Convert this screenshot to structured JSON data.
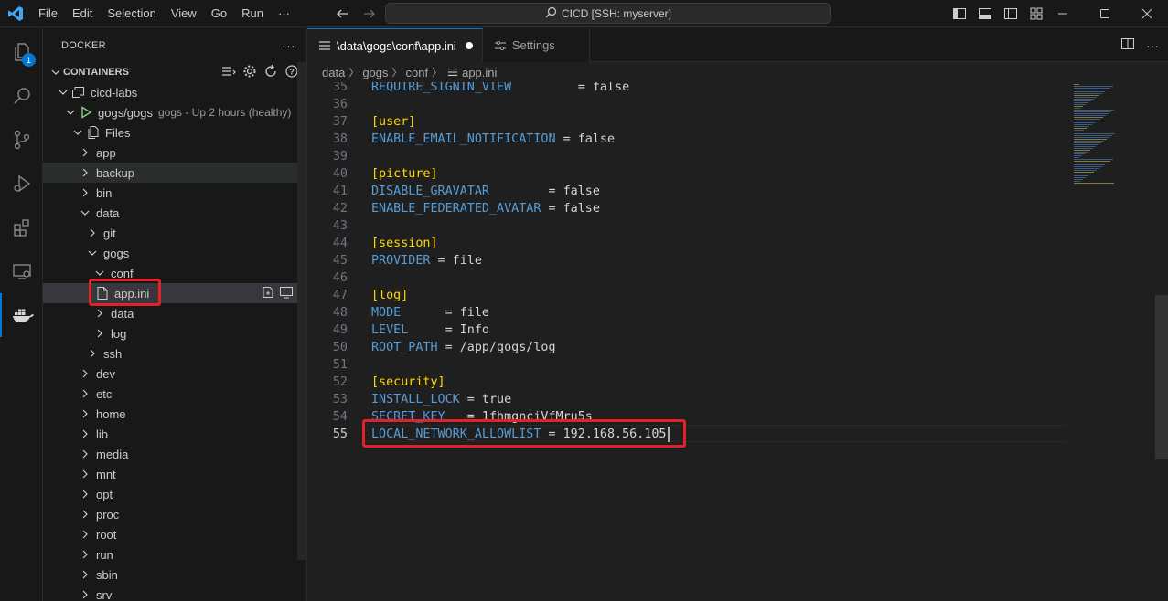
{
  "titlebar": {
    "menu": [
      "File",
      "Edit",
      "Selection",
      "View",
      "Go",
      "Run",
      "···"
    ],
    "command_center": "CICD [SSH: myserver]"
  },
  "activity_bar": {
    "explorer_badge": "1",
    "items": [
      "explorer-icon",
      "search-icon",
      "source-control-icon",
      "run-debug-icon",
      "extensions-icon",
      "remote-explorer-icon",
      "docker-icon"
    ]
  },
  "sidebar": {
    "title": "DOCKER",
    "more": "···",
    "section_title": "CONTAINERS",
    "tree": [
      {
        "label": "cicd-labs",
        "desc": ""
      },
      {
        "label": "gogs/gogs",
        "desc": "gogs - Up 2 hours (healthy)"
      },
      {
        "label": "Files",
        "desc": ""
      },
      {
        "label": "app"
      },
      {
        "label": "backup"
      },
      {
        "label": "bin"
      },
      {
        "label": "data"
      },
      {
        "label": "git"
      },
      {
        "label": "gogs"
      },
      {
        "label": "conf"
      },
      {
        "label": "app.ini"
      },
      {
        "label": "data"
      },
      {
        "label": "log"
      },
      {
        "label": "ssh"
      },
      {
        "label": "dev"
      },
      {
        "label": "etc"
      },
      {
        "label": "home"
      },
      {
        "label": "lib"
      },
      {
        "label": "media"
      },
      {
        "label": "mnt"
      },
      {
        "label": "opt"
      },
      {
        "label": "proc"
      },
      {
        "label": "root"
      },
      {
        "label": "run"
      },
      {
        "label": "sbin"
      },
      {
        "label": "srv"
      }
    ]
  },
  "editor": {
    "tabs": [
      {
        "label": "\\data\\gogs\\conf\\app.ini",
        "dirty": true
      },
      {
        "label": "Settings",
        "dirty": false
      }
    ],
    "breadcrumb": [
      "data",
      "gogs",
      "conf",
      "app.ini"
    ],
    "lines": [
      {
        "n": "35",
        "parts": [
          [
            "k",
            "REQUIRE_SIGNIN_VIEW"
          ],
          [
            "v",
            "         = false"
          ]
        ]
      },
      {
        "n": "36",
        "parts": []
      },
      {
        "n": "37",
        "parts": [
          [
            "s",
            "[user]"
          ]
        ]
      },
      {
        "n": "38",
        "parts": [
          [
            "k",
            "ENABLE_EMAIL_NOTIFICATION"
          ],
          [
            "v",
            " = false"
          ]
        ]
      },
      {
        "n": "39",
        "parts": []
      },
      {
        "n": "40",
        "parts": [
          [
            "s",
            "[picture]"
          ]
        ]
      },
      {
        "n": "41",
        "parts": [
          [
            "k",
            "DISABLE_GRAVATAR"
          ],
          [
            "v",
            "        = false"
          ]
        ]
      },
      {
        "n": "42",
        "parts": [
          [
            "k",
            "ENABLE_FEDERATED_AVATAR"
          ],
          [
            "v",
            " = false"
          ]
        ]
      },
      {
        "n": "43",
        "parts": []
      },
      {
        "n": "44",
        "parts": [
          [
            "s",
            "[session]"
          ]
        ]
      },
      {
        "n": "45",
        "parts": [
          [
            "k",
            "PROVIDER"
          ],
          [
            "v",
            " = file"
          ]
        ]
      },
      {
        "n": "46",
        "parts": []
      },
      {
        "n": "47",
        "parts": [
          [
            "s",
            "[log]"
          ]
        ]
      },
      {
        "n": "48",
        "parts": [
          [
            "k",
            "MODE"
          ],
          [
            "v",
            "      = file"
          ]
        ]
      },
      {
        "n": "49",
        "parts": [
          [
            "k",
            "LEVEL"
          ],
          [
            "v",
            "     = Info"
          ]
        ]
      },
      {
        "n": "50",
        "parts": [
          [
            "k",
            "ROOT_PATH"
          ],
          [
            "v",
            " = /app/gogs/log"
          ]
        ]
      },
      {
        "n": "51",
        "parts": []
      },
      {
        "n": "52",
        "parts": [
          [
            "s",
            "[security]"
          ]
        ]
      },
      {
        "n": "53",
        "parts": [
          [
            "k",
            "INSTALL_LOCK"
          ],
          [
            "v",
            " = true"
          ]
        ]
      },
      {
        "n": "54",
        "parts": [
          [
            "k",
            "SECRET_KEY"
          ],
          [
            "v",
            "   = 1fhmgnciVfMru5s"
          ]
        ]
      },
      {
        "n": "55",
        "parts": [
          [
            "k",
            "LOCAL_NETWORK_ALLOWLIST"
          ],
          [
            "v",
            " = 192.168.56.105"
          ]
        ]
      }
    ],
    "current_line": "55"
  },
  "colors": {
    "accent": "#0078d4",
    "highlight": "#e0222a",
    "section": "#ffd700",
    "key": "#569cd6",
    "container_running": "#89d185"
  }
}
